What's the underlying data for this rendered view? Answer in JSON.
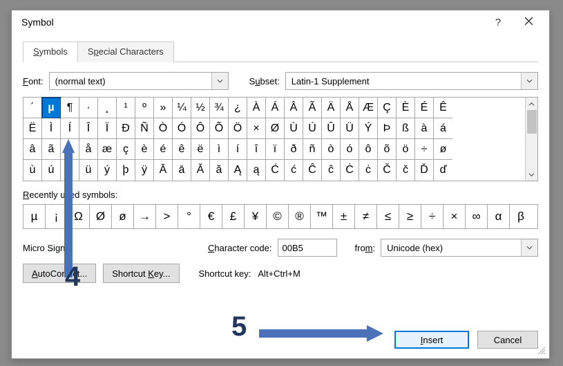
{
  "title": "Symbol",
  "help_glyph": "?",
  "tabs": {
    "symbols": "Symbols",
    "special": "Special Characters"
  },
  "font": {
    "label": "Font:",
    "value": "(normal text)"
  },
  "subset": {
    "label": "Subset:",
    "value": "Latin-1 Supplement"
  },
  "grid": [
    [
      "´",
      "µ",
      "¶",
      "·",
      "¸",
      "¹",
      "º",
      "»",
      "¼",
      "½",
      "¾",
      "¿",
      "À",
      "Á",
      "Â",
      "Ã",
      "Ä",
      "Å",
      "Æ",
      "Ç",
      "È",
      "É",
      "Ê"
    ],
    [
      "Ë",
      "Ì",
      "Í",
      "Î",
      "Ï",
      "Ð",
      "Ñ",
      "Ò",
      "Ó",
      "Ô",
      "Õ",
      "Ö",
      "×",
      "Ø",
      "Ù",
      "Ú",
      "Û",
      "Ü",
      "Ý",
      "Þ",
      "ß",
      "à",
      "á"
    ],
    [
      "â",
      "ã",
      "ä",
      "å",
      "æ",
      "ç",
      "è",
      "é",
      "ê",
      "ë",
      "ì",
      "í",
      "î",
      "ï",
      "ð",
      "ñ",
      "ò",
      "ó",
      "ô",
      "õ",
      "ö",
      "÷",
      "ø"
    ],
    [
      "ù",
      "ú",
      "û",
      "ü",
      "ý",
      "þ",
      "ÿ",
      "Ā",
      "ā",
      "Ă",
      "ă",
      "Ą",
      "ą",
      "Ć",
      "ć",
      "Ĉ",
      "ĉ",
      "Ċ",
      "ċ",
      "Č",
      "č",
      "Ď",
      "ď"
    ]
  ],
  "grid_selected": {
    "row": 0,
    "col": 1
  },
  "recent_label": "Recently used symbols:",
  "recent": [
    "µ",
    "¡",
    "Ω",
    "Ø",
    "ø",
    "→",
    ">",
    "°",
    "€",
    "£",
    "¥",
    "©",
    "®",
    "™",
    "±",
    "≠",
    "≤",
    "≥",
    "÷",
    "×",
    "∞",
    "α",
    "β"
  ],
  "name": "Micro Sign",
  "charcode": {
    "label": "Character code:",
    "value": "00B5"
  },
  "from": {
    "label": "from:",
    "value": "Unicode (hex)"
  },
  "buttons": {
    "autocorrect": "AutoCorrect...",
    "shortcutkey": "Shortcut Key...",
    "shortcut_label": "Shortcut key:",
    "shortcut_value": "Alt+Ctrl+M",
    "insert": "Insert",
    "cancel": "Cancel"
  },
  "annotations": {
    "step4": "4",
    "step5": "5"
  }
}
